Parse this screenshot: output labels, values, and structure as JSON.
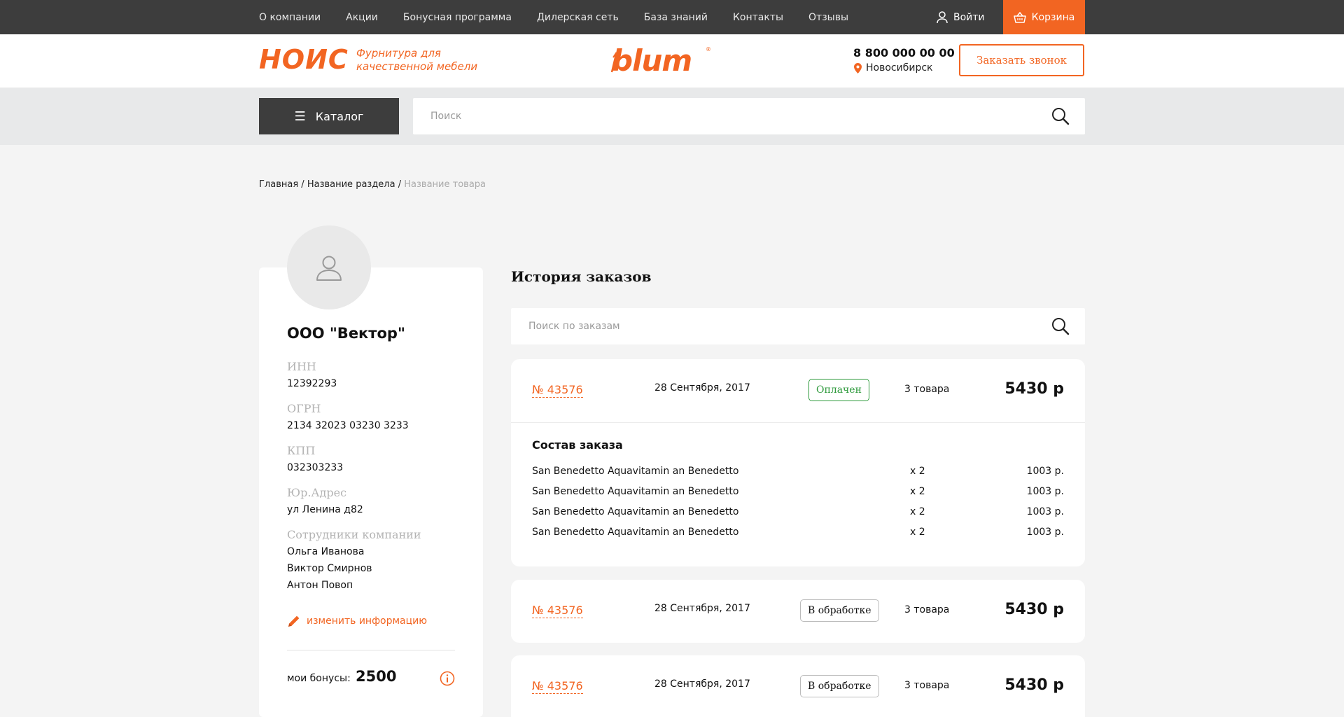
{
  "topnav": {
    "items": [
      "О компании",
      "Акции",
      "Бонусная программа",
      "Дилерская сеть",
      "База знаний",
      "Контакты",
      "Отзывы"
    ],
    "login": "Войти",
    "cart": "Корзина"
  },
  "header": {
    "logo": "НОИС",
    "tagline_1": "Фурнитура для",
    "tagline_2": "качественной мебели",
    "brand": "blum",
    "brand_reg": "®",
    "phone": "8 800 000 00 00",
    "city": "Новосибирск",
    "callback": "Заказать звонок"
  },
  "catalog": {
    "label": "Каталог",
    "search_placeholder": "Поиск"
  },
  "breadcrumb": {
    "home": "Главная",
    "sep": "/",
    "section": "Название раздела",
    "current": "Название товара"
  },
  "profile": {
    "company": "ООО \"Вектор\"",
    "inn_label": "ИНН",
    "inn": "12392293",
    "ogrn_label": "ОГРН",
    "ogrn": "2134 32023 03230 3233",
    "kpp_label": "КПП",
    "kpp": "032303233",
    "address_label": "Юр.Адрес",
    "address": "ул Ленина д82",
    "employees_label": "Сотрудники компании",
    "employees": [
      "Ольга Иванова",
      "Виктор Смирнов",
      "Антон Повоп"
    ],
    "edit": "изменить информацию",
    "bonus_label": "мои бонусы:",
    "bonus_value": "2500"
  },
  "orders": {
    "title": "История заказов",
    "search_placeholder": "Поиск по заказам",
    "composition_title": "Состав заказа",
    "list": [
      {
        "number": "№ 43576",
        "date": "28 Сентября, 2017",
        "status": "Оплачен",
        "count": "3 товара",
        "total": "5430 р",
        "items": [
          {
            "name": "San Benedetto Aquavitamin an Benedetto",
            "qty": "x 2",
            "price": "1003 р."
          },
          {
            "name": "San Benedetto Aquavitamin an Benedetto",
            "qty": "x 2",
            "price": "1003 р."
          },
          {
            "name": "San Benedetto Aquavitamin an Benedetto",
            "qty": "x 2",
            "price": "1003 р."
          },
          {
            "name": "San Benedetto Aquavitamin an Benedetto",
            "qty": "x 2",
            "price": "1003 р."
          }
        ]
      },
      {
        "number": "№ 43576",
        "date": "28 Сентября, 2017",
        "status": "В обработке",
        "count": "3 товара",
        "total": "5430 р"
      },
      {
        "number": "№ 43576",
        "date": "28 Сентября, 2017",
        "status": "В обработке",
        "count": "3 товара",
        "total": "5430 р"
      }
    ]
  },
  "colors": {
    "accent": "#f26522",
    "dark": "#3d3d3d",
    "paid": "#2e9a3c"
  }
}
